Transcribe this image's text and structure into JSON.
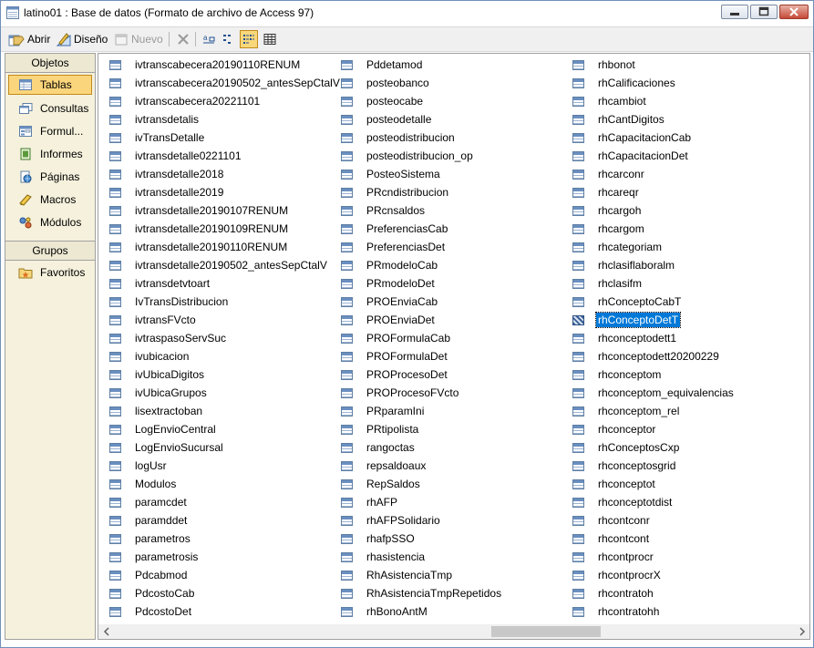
{
  "window": {
    "title": "latino01 : Base de datos (Formato de archivo de Access 97)"
  },
  "toolbar": {
    "open_label": "Abrir",
    "design_label": "Diseño",
    "new_label": "Nuevo"
  },
  "sidebar": {
    "objects_header": "Objetos",
    "items": [
      {
        "label": "Tablas",
        "icon": "table-icon",
        "selected": true
      },
      {
        "label": "Consultas",
        "icon": "query-icon"
      },
      {
        "label": "Formul...",
        "icon": "form-icon"
      },
      {
        "label": "Informes",
        "icon": "report-icon"
      },
      {
        "label": "Páginas",
        "icon": "page-icon"
      },
      {
        "label": "Macros",
        "icon": "macro-icon"
      },
      {
        "label": "Módulos",
        "icon": "module-icon"
      }
    ],
    "groups_header": "Grupos",
    "groups": [
      {
        "label": "Favoritos",
        "icon": "favorites-folder-icon"
      }
    ]
  },
  "tables": {
    "col1": [
      "ivtranscabecera20190110RENUM",
      "ivtranscabecera20190502_antesSepCtalV",
      "ivtranscabecera20221101",
      "ivtransdetalis",
      "ivTransDetalle",
      "ivtransdetalle0221101",
      "ivtransdetalle2018",
      "ivtransdetalle2019",
      "ivtransdetalle20190107RENUM",
      "ivtransdetalle20190109RENUM",
      "ivtransdetalle20190110RENUM",
      "ivtransdetalle20190502_antesSepCtalV",
      "ivtransdetvtoart",
      "IvTransDistribucion",
      "ivtransFVcto",
      "ivtraspasoServSuc",
      "ivubicacion",
      "ivUbicaDigitos",
      "ivUbicaGrupos",
      "lisextractoban",
      "LogEnvioCentral",
      "LogEnvioSucursal",
      "logUsr",
      "Modulos",
      "paramcdet",
      "paramddet",
      "parametros",
      "parametrosis",
      "Pdcabmod",
      "PdcostoCab",
      "PdcostoDet"
    ],
    "col2": [
      "Pddetamod",
      "posteobanco",
      "posteocabe",
      "posteodetalle",
      "posteodistribucion",
      "posteodistribucion_op",
      "PosteoSistema",
      "PRcndistribucion",
      "PRcnsaldos",
      "PreferenciasCab",
      "PreferenciasDet",
      "PRmodeloCab",
      "PRmodeloDet",
      "PROEnviaCab",
      "PROEnviaDet",
      "PROFormulaCab",
      "PROFormulaDet",
      "PROProcesoDet",
      "PROProcesoFVcto",
      "PRparamIni",
      "PRtipolista",
      "rangoctas",
      "repsaldoaux",
      "RepSaldos",
      "rhAFP",
      "rhAFPSolidario",
      "rhafpSSO",
      "rhasistencia",
      "RhAsistenciaTmp",
      "RhAsistenciaTmpRepetidos",
      "rhBonoAntM"
    ],
    "col3": [
      "rhbonot",
      "rhCalificaciones",
      "rhcambiot",
      "rhCantDigitos",
      "rhCapacitacionCab",
      "rhCapacitacionDet",
      "rhcarconr",
      "rhcareqr",
      "rhcargoh",
      "rhcargom",
      "rhcategoriam",
      "rhclasiflaboralm",
      "rhclasifm",
      "rhConceptoCabT",
      "rhConceptoDetT",
      "rhconceptodett1",
      "rhconceptodett20200229",
      "rhconceptom",
      "rhconceptom_equivalencias",
      "rhconceptom_rel",
      "rhconceptor",
      "rhConceptosCxp",
      "rhconceptosgrid",
      "rhconceptot",
      "rhconceptotdist",
      "rhcontconr",
      "rhcontcont",
      "rhcontprocr",
      "rhcontprocrX",
      "rhcontratoh",
      "rhcontratohh"
    ],
    "selected_item": "rhConceptoDetT"
  }
}
